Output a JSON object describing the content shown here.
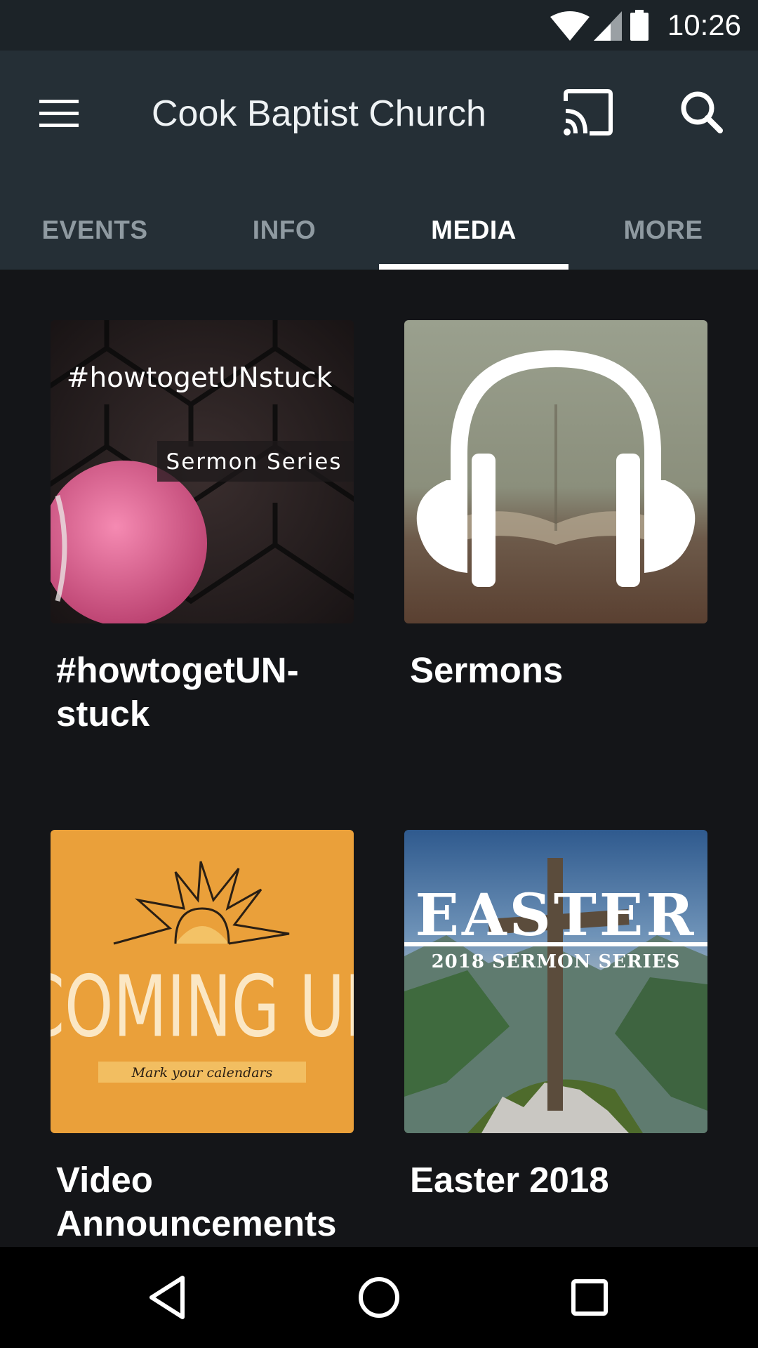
{
  "status": {
    "time": "10:26"
  },
  "app_bar": {
    "title": "Cook Baptist Church"
  },
  "tabs": [
    {
      "label": "EVENTS"
    },
    {
      "label": "INFO"
    },
    {
      "label": "MEDIA",
      "active": true
    },
    {
      "label": "MORE"
    }
  ],
  "media": [
    {
      "title": "#howtogetUN-\nstuck",
      "art_heading": "#howtogetUNstuck",
      "art_sub": "Sermon Series"
    },
    {
      "title": "Sermons"
    },
    {
      "title": "Video\nAnnouncements",
      "art_heading": "COMING UP",
      "art_sub": "Mark your calendars"
    },
    {
      "title": "Easter 2018",
      "art_heading": "EASTER",
      "art_sub": "2018 SERMON SERIES"
    }
  ],
  "colors": {
    "app_bar": "#252f36",
    "status_bar": "#1c2328",
    "background": "#141518",
    "accent": "#ffffff"
  }
}
